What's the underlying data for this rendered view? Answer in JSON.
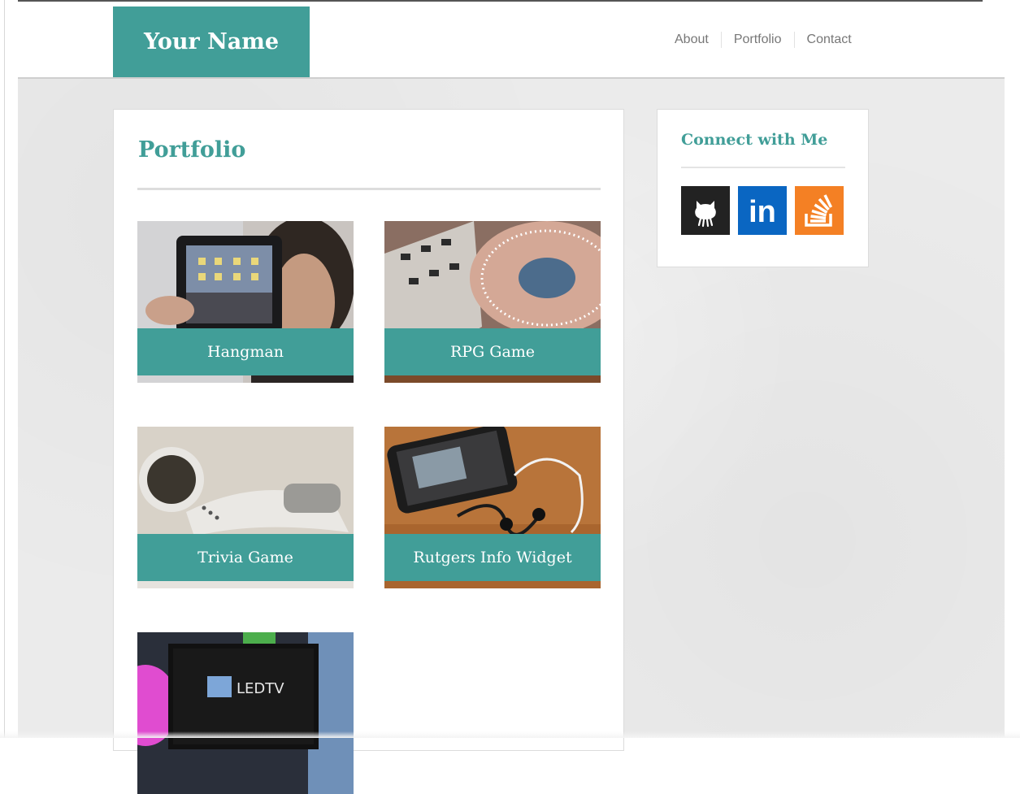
{
  "brand": {
    "name": "Your Name"
  },
  "nav": {
    "items": [
      "About",
      "Portfolio",
      "Contact"
    ]
  },
  "main": {
    "title": "Portfolio",
    "cards": [
      {
        "caption": "Hangman"
      },
      {
        "caption": "RPG Game"
      },
      {
        "caption": "Trivia Game"
      },
      {
        "caption": "Rutgers Info Widget"
      },
      {
        "caption": ""
      }
    ],
    "led_logo_text": "LEDTV"
  },
  "sidebar": {
    "title": "Connect with Me",
    "links": [
      {
        "icon": "github-icon",
        "color": "#222222"
      },
      {
        "icon": "linkedin-icon",
        "color": "#0a66c2",
        "text": "in"
      },
      {
        "icon": "stackoverflow-icon",
        "color": "#f48024"
      }
    ]
  },
  "colors": {
    "accent": "#419e98",
    "background": "#ebebeb"
  }
}
